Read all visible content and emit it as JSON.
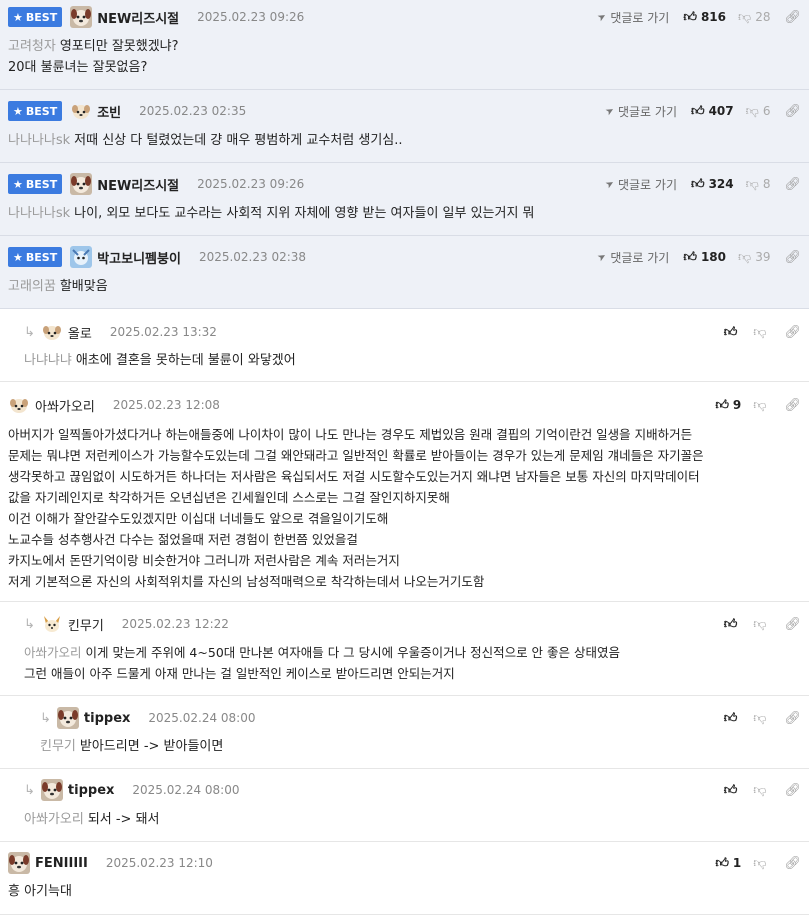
{
  "ui": {
    "best_label": "BEST",
    "reply_label": "댓글로 가기"
  },
  "comments": [
    {
      "best": true,
      "nick": "NEW리즈시절",
      "date": "2025.02.23  09:26",
      "likes": "816",
      "dislikes": "28",
      "mention": "고려청자",
      "lines": [
        "영포티만 잘못했겠냐?",
        "20대 불륜녀는 잘못없음?"
      ]
    },
    {
      "best": true,
      "nick": "조빈",
      "date": "2025.02.23  02:35",
      "likes": "407",
      "dislikes": "6",
      "mention": "나나나나sk",
      "lines": [
        "저때 신상 다 털렸었는데 걍 매우 평범하게 교수처럼 생기심.."
      ]
    },
    {
      "best": true,
      "nick": "NEW리즈시절",
      "date": "2025.02.23  09:26",
      "likes": "324",
      "dislikes": "8",
      "mention": "나나나나sk",
      "lines": [
        "나이, 외모 보다도 교수라는 사회적 지위 자체에 영향 받는 여자들이 일부 있는거지 뭐"
      ]
    },
    {
      "best": true,
      "nick": "박고보니펨붕이",
      "date": "2025.02.23  02:38",
      "likes": "180",
      "dislikes": "39",
      "mention": "고래의꿈",
      "lines": [
        "할배맞음"
      ]
    },
    {
      "best": false,
      "nick": "올로",
      "date": "2025.02.23  13:32",
      "likes": "",
      "dislikes": "",
      "mention": "나냐냐냐",
      "lines": [
        "애초에 결혼을 못하는데 불륜이 와닿겠어"
      ]
    },
    {
      "best": false,
      "nick": "아쏴가오리",
      "date": "2025.02.23  12:08",
      "likes": "9",
      "dislikes": "",
      "mention": "",
      "lines": [
        "아버지가 일찍돌아가셨다거나 하는애들중에 나이차이 많이 나도 만나는 경우도 제법있음 원래 결핍의 기억이란건 일생을 지배하거든",
        "문제는 뭐냐면 저런케이스가 가능할수도있는데 그걸 왜안돼라고 일반적인 확률로 받아들이는 경우가 있는게 문제임 걔네들은 자기꼴은",
        "생각못하고 끊임없이 시도하거든 하나더는 저사람은 육십되서도 저걸 시도할수도있는거지 왜냐면 남자들은 보통 자신의 마지막데이터",
        "값을 자기레인지로 착각하거든 오년십년은 긴세월인데 스스로는 그걸 잘인지하지못해",
        "이건 이해가 잘안갈수도있겠지만 이십대 너네들도 앞으로 겪을일이기도해",
        "노교수들 성추행사건 다수는 젊었을때 저런 경험이 한번쯤 있었을걸",
        "카지노에서 돈딴기억이랑 비슷한거야 그러니까 저런사람은 계속 저러는거지",
        "저게 기본적으론 자신의 사회적위치를 자신의 남성적매력으로 착각하는데서 나오는거기도함"
      ]
    },
    {
      "best": false,
      "nick": "킨무기",
      "date": "2025.02.23  12:22",
      "likes": "",
      "dislikes": "",
      "mention": "아쏴가오리",
      "lines": [
        "이게 맞는게 주위에 4~50대 만나본 여자애들 다 그 당시에 우울증이거나 정신적으로 안 좋은 상태였음",
        "그런 애들이 아주 드물게 아재 만나는 걸 일반적인 케이스로 받아드리면 안되는거지"
      ]
    },
    {
      "best": false,
      "nick": "tippex",
      "date": "2025.02.24  08:00",
      "likes": "",
      "dislikes": "",
      "mention": "킨무기",
      "lines": [
        "받아드리면 -> 받아들이면"
      ]
    },
    {
      "best": false,
      "nick": "tippex",
      "date": "2025.02.24  08:00",
      "likes": "",
      "dislikes": "",
      "mention": "아쏴가오리",
      "lines": [
        "되서 -> 돼서"
      ]
    },
    {
      "best": false,
      "nick": "FENIIIII",
      "date": "2025.02.23  12:10",
      "likes": "1",
      "dislikes": "",
      "mention": "",
      "lines": [
        "흥 아기늑대"
      ]
    }
  ],
  "icons": {
    "star": "star-icon",
    "reply": "reply-arrow-icon",
    "thumbs_up": "thumbs-up-icon",
    "thumbs_down": "thumbs-down-icon",
    "link": "link-icon",
    "nested": "nested-reply-icon"
  }
}
